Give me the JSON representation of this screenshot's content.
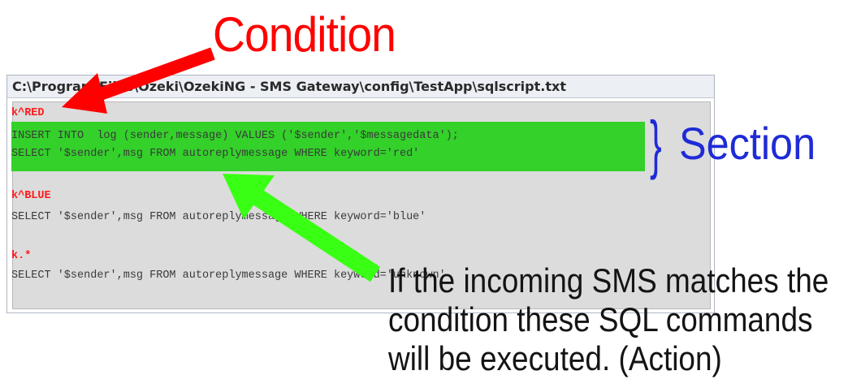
{
  "condition_label": "Condition",
  "section_label": "Section",
  "brace": "}",
  "editor": {
    "title": "C:\\Program Files\\Ozeki\\OzekiNG - SMS Gateway\\config\\TestApp\\sqlscript.txt",
    "lines": [
      {
        "text": "k^RED",
        "kind": "rule"
      },
      {
        "text": "INSERT INTO  log (sender,message) VALUES ('$sender','$messagedata');",
        "kind": "sql"
      },
      {
        "text": "SELECT '$sender',msg FROM autoreplymessage WHERE keyword='red'",
        "kind": "sql"
      },
      {
        "text": "k^BLUE",
        "kind": "rule"
      },
      {
        "text": "SELECT '$sender',msg FROM autoreplymessage WHERE keyword='blue'",
        "kind": "sql"
      },
      {
        "text": "k.*",
        "kind": "rule"
      },
      {
        "text": "SELECT '$sender',msg FROM autoreplymessage WHERE keyword='unknown'",
        "kind": "sql"
      }
    ]
  },
  "explanation": [
    "If the incoming SMS matches the",
    "condition these SQL commands",
    "will be executed. (Action)"
  ],
  "colors": {
    "condition": "#ff0000",
    "section": "#1f2bd6",
    "highlight": "#33d12a",
    "green_arrow": "#39ff14",
    "red_arrow": "#ff0000"
  }
}
